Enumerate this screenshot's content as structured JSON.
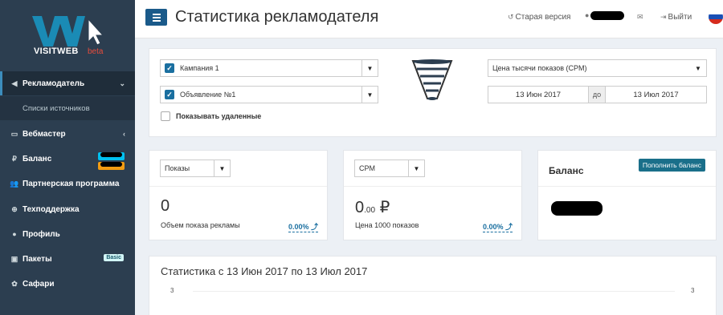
{
  "sidebar": {
    "logo_text": "VISITWEB",
    "logo_beta": "beta",
    "items": [
      {
        "label": "Рекламодатель"
      },
      {
        "label": "Списки источников"
      },
      {
        "label": "Вебмастер"
      },
      {
        "label": "Баланс"
      },
      {
        "label": "Партнерская программа"
      },
      {
        "label": "Техподдержка"
      },
      {
        "label": "Профиль"
      },
      {
        "label": "Пакеты",
        "badge": "Basic"
      },
      {
        "label": "Сафари"
      }
    ]
  },
  "header": {
    "title": "Статистика рекламодателя",
    "old_version": "Старая версия",
    "logout": "Выйти"
  },
  "filters": {
    "campaign": "Кампания 1",
    "ad": "Объявление №1",
    "show_deleted": "Показывать удаленные",
    "metric": "Цена тысячи показов (CPM)",
    "date_from": "13 Июн 2017",
    "date_sep": "до",
    "date_to": "13 Июл 2017"
  },
  "cards": {
    "impressions": {
      "select": "Показы",
      "value": "0",
      "label": "Объем показа рекламы",
      "pct": "0.00%"
    },
    "cpm": {
      "select": "CPM",
      "value_int": "0",
      "value_dec": ".00",
      "currency": "₽",
      "label": "Цена 1000 показов",
      "pct": "0.00%"
    },
    "balance": {
      "title": "Баланс",
      "button": "Пополнить баланс"
    }
  },
  "stats": {
    "title": "Статистика с 13 Июн 2017 по 13 Июл 2017",
    "y_left": "3",
    "y_right": "3"
  },
  "colors": {
    "sidebar": "#2c3e50",
    "accent": "#1a6fa0",
    "logo": "#1a8bb5"
  }
}
